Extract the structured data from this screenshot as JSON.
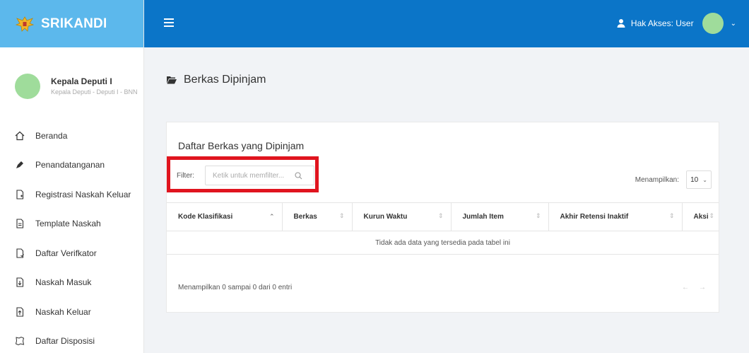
{
  "app": {
    "brand": "SRIKANDI"
  },
  "profile": {
    "name": "Kepala Deputi I",
    "subtitle": "Kepala Deputi - Deputi I - BNN"
  },
  "topbar": {
    "access_label": "Hak Akses: User"
  },
  "sidebar": {
    "items": [
      {
        "label": "Beranda",
        "icon": "home-icon"
      },
      {
        "label": "Penandatanganan",
        "icon": "pen-icon"
      },
      {
        "label": "Registrasi Naskah Keluar",
        "icon": "file-plus-icon"
      },
      {
        "label": "Template Naskah",
        "icon": "file-text-icon"
      },
      {
        "label": "Daftar Verifkator",
        "icon": "file-check-icon"
      },
      {
        "label": "Naskah Masuk",
        "icon": "file-download-icon"
      },
      {
        "label": "Naskah Keluar",
        "icon": "file-upload-icon"
      },
      {
        "label": "Daftar Disposisi",
        "icon": "disposisi-icon"
      }
    ]
  },
  "page": {
    "title": "Berkas Dipinjam"
  },
  "card": {
    "title": "Daftar Berkas yang Dipinjam",
    "filter_label": "Filter:",
    "filter_placeholder": "Ketik untuk memfilter...",
    "show_label": "Menampilkan:",
    "show_value": "10",
    "columns": [
      "Kode Klasifikasi",
      "Berkas",
      "Kurun Waktu",
      "Jumlah Item",
      "Akhir Retensi Inaktif",
      "Aksi"
    ],
    "empty_text": "Tidak ada data yang tersedia pada tabel ini",
    "info_text": "Menampilkan 0 sampai 0 dari 0 entri",
    "pager": {
      "prev": "←",
      "next": "→"
    }
  },
  "colors": {
    "brand_bar": "#5cb8ec",
    "topbar": "#0b75c8",
    "highlight": "#e0141e",
    "avatar": "#9fdc9b"
  }
}
